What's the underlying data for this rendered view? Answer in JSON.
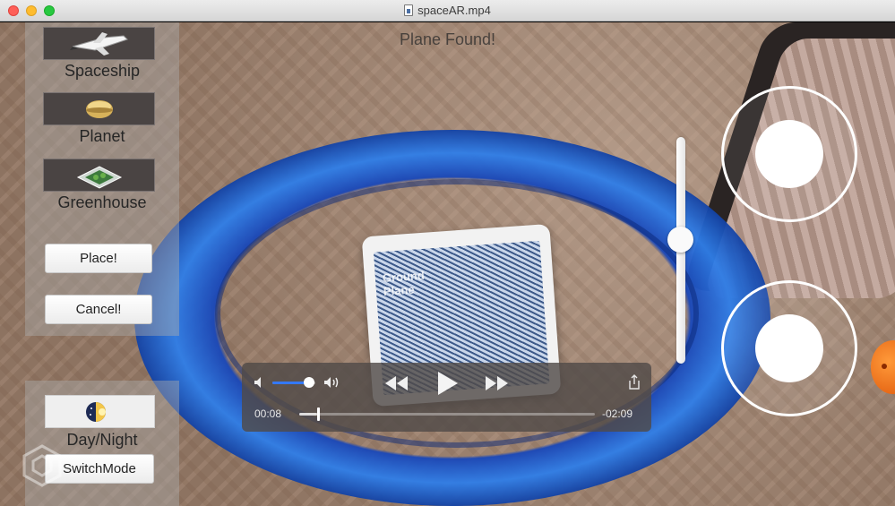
{
  "window": {
    "title": "spaceAR.mp4"
  },
  "scene": {
    "status_text": "Plane Found!",
    "ipad_text": "Ground\nPlane"
  },
  "left_panel": {
    "models": [
      {
        "label": "Spaceship",
        "icon": "spaceship-icon"
      },
      {
        "label": "Planet",
        "icon": "planet-icon"
      },
      {
        "label": "Greenhouse",
        "icon": "greenhouse-icon"
      }
    ],
    "place_label": "Place!",
    "cancel_label": "Cancel!",
    "daynight_label": "Day/Night",
    "switchmode_label": "SwitchMode"
  },
  "slider": {
    "value": 0.55
  },
  "player": {
    "current_time": "00:08",
    "remaining_time": "-02:09",
    "volume": 0.85,
    "progress": 0.06
  },
  "colors": {
    "accent": "#3478f6",
    "ring_blue": "#2f7ee8"
  }
}
